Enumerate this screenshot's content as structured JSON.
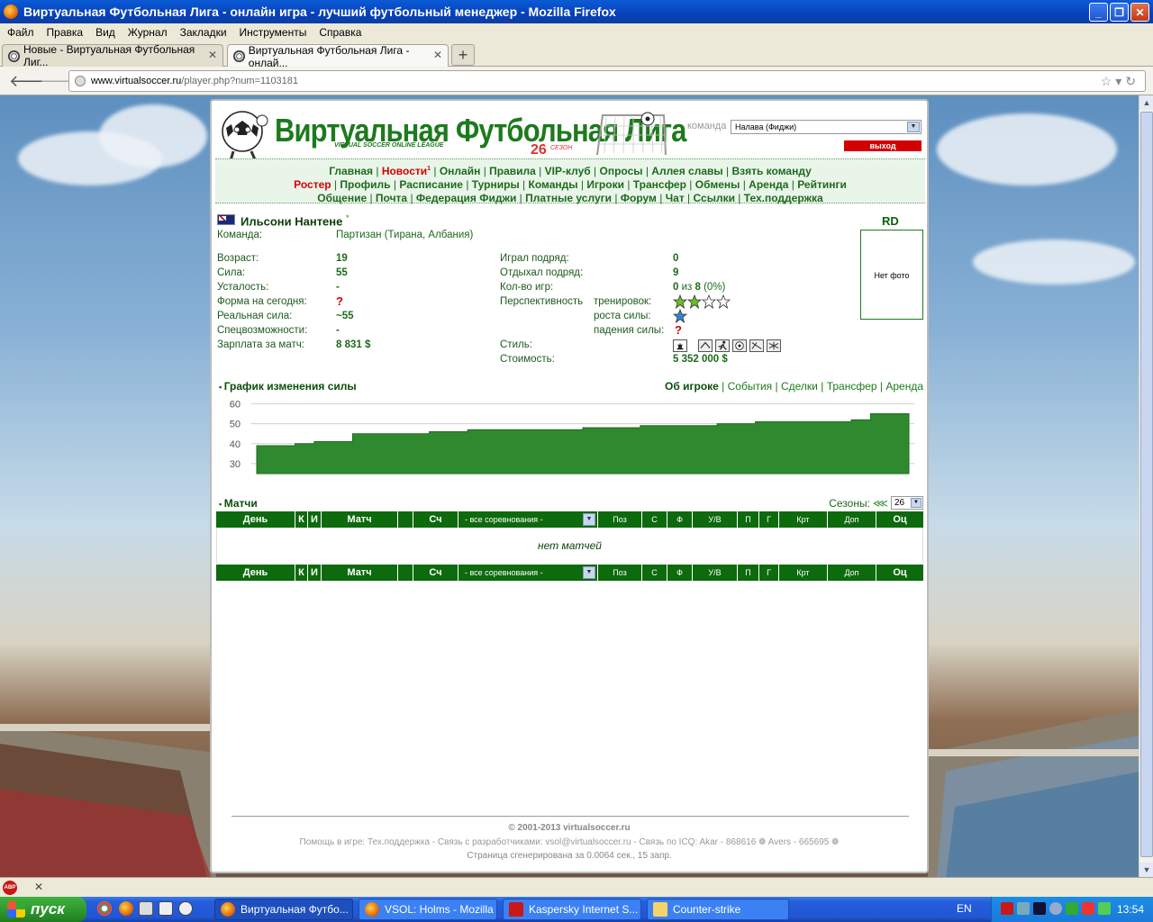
{
  "window": {
    "title": "Виртуальная Футбольная Лига - онлайн игра - лучший футбольный менеджер - Mozilla Firefox",
    "buttons": [
      "_",
      "❐",
      "✕"
    ]
  },
  "menu": [
    "Файл",
    "Правка",
    "Вид",
    "Журнал",
    "Закладки",
    "Инструменты",
    "Справка"
  ],
  "tabs": [
    {
      "label": "Новые - Виртуальная Футбольная Лиг..."
    },
    {
      "label": "Виртуальная Футбольная Лига - онлай..."
    }
  ],
  "url": {
    "domain": "www.virtualsoccer.ru",
    "path": "/player.php?num=1103181"
  },
  "site": {
    "logo_title": "Виртуальная Футбольная Лига",
    "logo_sub": "VIRTUAL SOCCER ONLINE LEAGUE",
    "season_number": "26",
    "season_label": "СЕЗОН",
    "team_label": "команда",
    "team_value": "Налава (Фиджи)",
    "logout": "выход"
  },
  "nav": {
    "line1": [
      "Главная",
      "Новости",
      "Онлайн",
      "Правила",
      "VIP-клуб",
      "Опросы",
      "Аллея славы",
      "Взять команду"
    ],
    "news_badge": "1",
    "line2": [
      "Ростер",
      "Профиль",
      "Расписание",
      "Турниры",
      "Команды",
      "Игроки",
      "Трансфер",
      "Обмены",
      "Аренда",
      "Рейтинги"
    ],
    "line3": [
      "Общение",
      "Почта",
      "Федерация Фиджи",
      "Платные услуги",
      "Форум",
      "Чат",
      "Ссылки",
      "Тех.поддержка"
    ]
  },
  "player": {
    "name": "Ильсони Нантене",
    "name_mark": "*",
    "position": "RD",
    "photo": "Нет фото",
    "team_label": "Команда:",
    "team": "Партизан (Тирана, Албания)",
    "left": [
      {
        "label": "Возраст:",
        "value": "19"
      },
      {
        "label": "Сила:",
        "value": "55"
      },
      {
        "label": "Усталость:",
        "value": "-"
      },
      {
        "label": "Форма на сегодня:",
        "value": "?"
      },
      {
        "label": "Реальная сила:",
        "value": "~55"
      },
      {
        "label": "Спецвозможности:",
        "value": "-"
      },
      {
        "label": "Зарплата за матч:",
        "value": "8 831 $"
      }
    ],
    "right": [
      {
        "label": "Играл подряд:",
        "value": "0"
      },
      {
        "label": "Отдыхал подряд:",
        "value": "9"
      },
      {
        "label": "Кол-во игр:",
        "value_a": "0",
        "value_mid": " из ",
        "value_b": "8",
        "value_pct": " (0%)"
      }
    ],
    "prospect_label": "Перспективность",
    "prospect": [
      {
        "label": "тренировок:",
        "stars_filled": 2,
        "stars_total": 4
      },
      {
        "label": "роста силы:",
        "stars_filled": 1,
        "stars_total": 1
      },
      {
        "label": "падения силы:",
        "value": "?"
      }
    ],
    "style_label": "Стиль:",
    "cost_label": "Стоимость:",
    "cost": "5 352 000 $"
  },
  "chart_section": {
    "title": "График изменения силы",
    "links": [
      "Об игроке",
      "События",
      "Сделки",
      "Трансфер",
      "Аренда"
    ]
  },
  "chart_data": {
    "type": "area",
    "title": "",
    "xlabel": "",
    "ylabel": "",
    "ylim": [
      25,
      62
    ],
    "yticks": [
      60,
      50,
      40,
      30
    ],
    "series": [
      {
        "values": [
          39,
          39,
          40,
          41,
          41,
          45,
          45,
          45,
          45,
          46,
          46,
          47,
          47,
          47,
          47,
          47,
          47,
          48,
          48,
          48,
          49,
          49,
          49,
          49,
          50,
          50,
          51,
          51,
          51,
          51,
          51,
          52,
          55,
          55
        ]
      }
    ],
    "color": "#2f8a2f",
    "grid": true
  },
  "matches": {
    "title": "Матчи",
    "seasons_label": "Сезоны:",
    "seasons_arrows": "⋘",
    "season_value": "26",
    "headers": [
      "День",
      "К",
      "И",
      "Матч",
      "",
      "Сч",
      "- все соревнования -",
      "Поз",
      "С",
      "Ф",
      "У/В",
      "П",
      "Г",
      "Крт",
      "Доп",
      "Оц"
    ],
    "empty": "нет матчей"
  },
  "footer": {
    "copyright": "© 2001-2013 virtualsoccer.ru",
    "help": "Помощь в игре: Тех.поддержка - Связь с разработчиками: vsol@virtualsoccer.ru - Связь по ICQ: Akar - 868616 ❁ Avers - 665695 ❁",
    "generated": "Страница сгенерирована за 0.0064 сек., 15 запр."
  },
  "statusbar": {
    "abp": "ABP",
    "close": "✕"
  },
  "taskbar": {
    "start": "пуск",
    "tasks": [
      {
        "label": "Виртуальная Футбо...",
        "active": true
      },
      {
        "label": "VSOL: Holms - Mozilla ...",
        "active": false
      },
      {
        "label": "Kaspersky Internet S...",
        "active": false
      },
      {
        "label": "Counter-strike",
        "active": false
      }
    ],
    "lang": "EN",
    "clock": "13:54"
  }
}
